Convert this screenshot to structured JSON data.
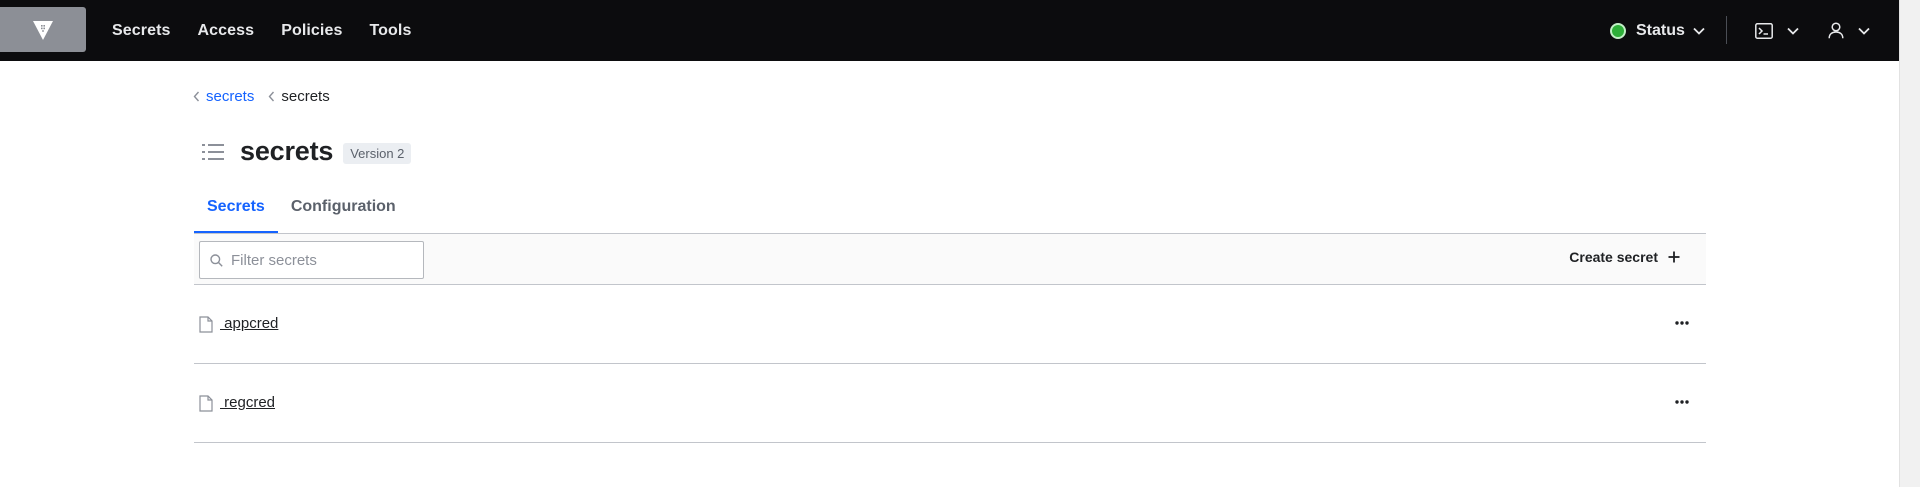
{
  "nav": {
    "links": [
      "Secrets",
      "Access",
      "Policies",
      "Tools"
    ],
    "status_label": "Status"
  },
  "breadcrumb": {
    "items": [
      {
        "label": "secrets",
        "link": true
      },
      {
        "label": "secrets",
        "link": false
      }
    ]
  },
  "header": {
    "title": "secrets",
    "version_badge": "Version 2"
  },
  "tabs": [
    {
      "label": "Secrets",
      "active": true
    },
    {
      "label": "Configuration",
      "active": false
    }
  ],
  "toolbar": {
    "filter_placeholder": "Filter secrets",
    "create_label": "Create secret"
  },
  "secrets": [
    {
      "name": " appcred"
    },
    {
      "name": " regcred"
    }
  ],
  "colors": {
    "nav_bg": "#0c0c0e",
    "accent": "#1563ff",
    "status_ok": "#2eb039"
  },
  "icons": {
    "logo": "vault-logo-icon",
    "status": "status-dot-icon",
    "console": "terminal-icon",
    "user": "user-icon",
    "breadcrumb": "chevron-left-icon",
    "title": "list-icon",
    "search": "search-icon",
    "create": "plus-icon",
    "item": "file-icon",
    "item_menu": "more-horizontal-icon"
  }
}
